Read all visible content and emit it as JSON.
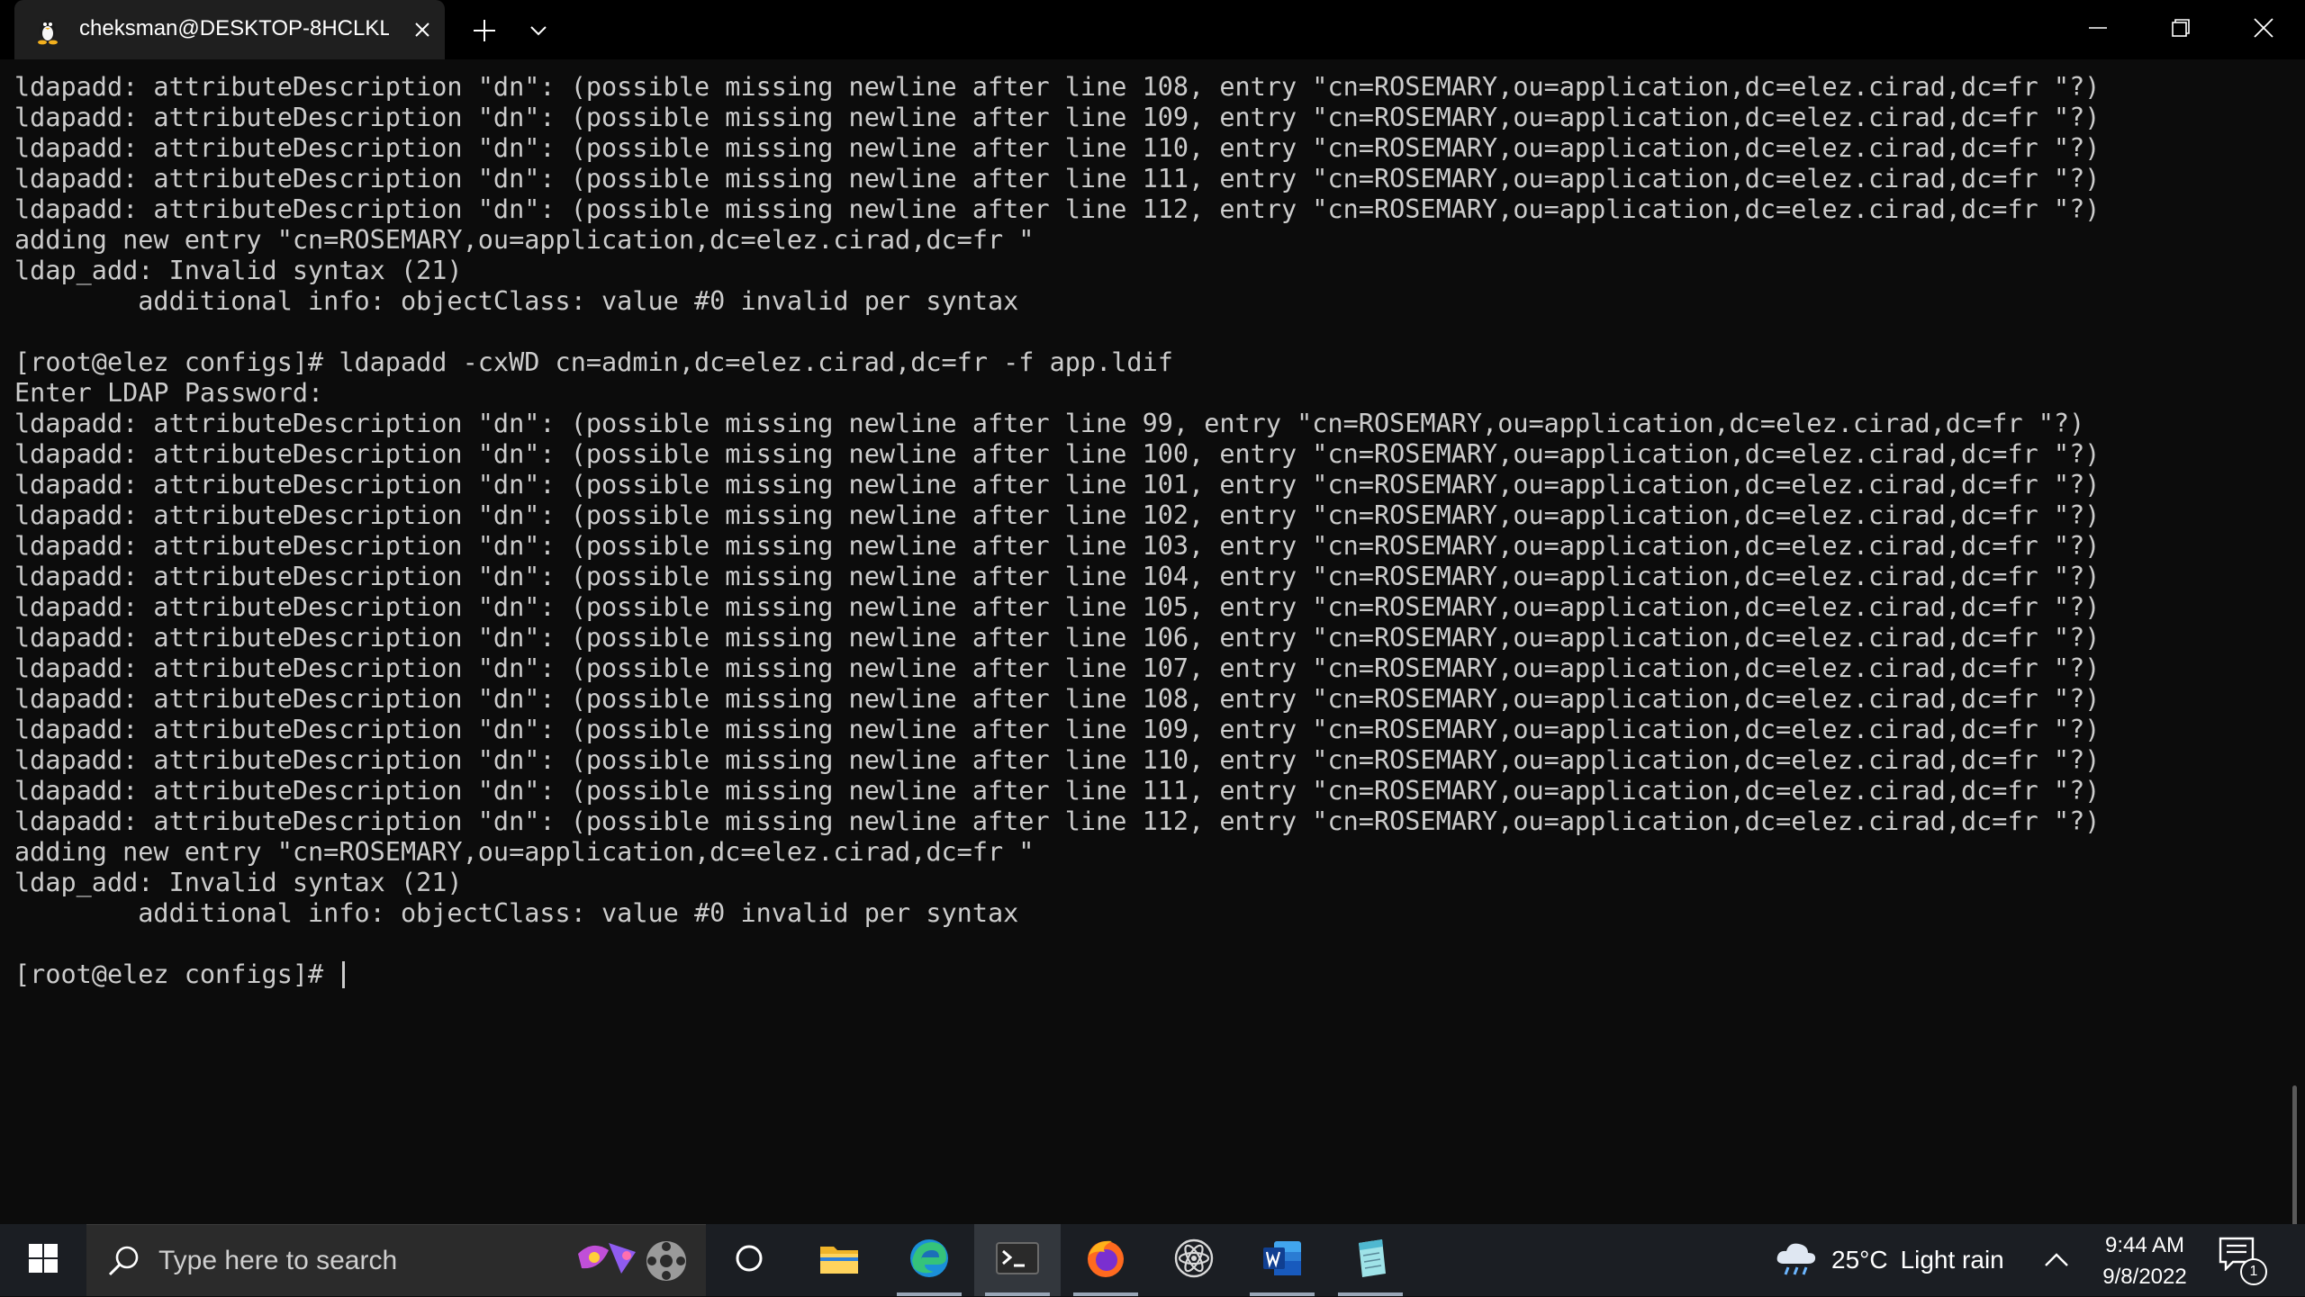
{
  "window": {
    "tab_title": "cheksman@DESKTOP-8HCLKL",
    "tab_icon": "linux-tux-icon"
  },
  "terminal": {
    "lines": [
      "ldapadd: attributeDescription \"dn\": (possible missing newline after line 108, entry \"cn=ROSEMARY,ou=application,dc=elez.cirad,dc=fr \"?)",
      "ldapadd: attributeDescription \"dn\": (possible missing newline after line 109, entry \"cn=ROSEMARY,ou=application,dc=elez.cirad,dc=fr \"?)",
      "ldapadd: attributeDescription \"dn\": (possible missing newline after line 110, entry \"cn=ROSEMARY,ou=application,dc=elez.cirad,dc=fr \"?)",
      "ldapadd: attributeDescription \"dn\": (possible missing newline after line 111, entry \"cn=ROSEMARY,ou=application,dc=elez.cirad,dc=fr \"?)",
      "ldapadd: attributeDescription \"dn\": (possible missing newline after line 112, entry \"cn=ROSEMARY,ou=application,dc=elez.cirad,dc=fr \"?)",
      "adding new entry \"cn=ROSEMARY,ou=application,dc=elez.cirad,dc=fr \"",
      "ldap_add: Invalid syntax (21)",
      "        additional info: objectClass: value #0 invalid per syntax",
      "",
      "[root@elez configs]# ldapadd -cxWD cn=admin,dc=elez.cirad,dc=fr -f app.ldif",
      "Enter LDAP Password:",
      "ldapadd: attributeDescription \"dn\": (possible missing newline after line 99, entry \"cn=ROSEMARY,ou=application,dc=elez.cirad,dc=fr \"?)",
      "ldapadd: attributeDescription \"dn\": (possible missing newline after line 100, entry \"cn=ROSEMARY,ou=application,dc=elez.cirad,dc=fr \"?)",
      "ldapadd: attributeDescription \"dn\": (possible missing newline after line 101, entry \"cn=ROSEMARY,ou=application,dc=elez.cirad,dc=fr \"?)",
      "ldapadd: attributeDescription \"dn\": (possible missing newline after line 102, entry \"cn=ROSEMARY,ou=application,dc=elez.cirad,dc=fr \"?)",
      "ldapadd: attributeDescription \"dn\": (possible missing newline after line 103, entry \"cn=ROSEMARY,ou=application,dc=elez.cirad,dc=fr \"?)",
      "ldapadd: attributeDescription \"dn\": (possible missing newline after line 104, entry \"cn=ROSEMARY,ou=application,dc=elez.cirad,dc=fr \"?)",
      "ldapadd: attributeDescription \"dn\": (possible missing newline after line 105, entry \"cn=ROSEMARY,ou=application,dc=elez.cirad,dc=fr \"?)",
      "ldapadd: attributeDescription \"dn\": (possible missing newline after line 106, entry \"cn=ROSEMARY,ou=application,dc=elez.cirad,dc=fr \"?)",
      "ldapadd: attributeDescription \"dn\": (possible missing newline after line 107, entry \"cn=ROSEMARY,ou=application,dc=elez.cirad,dc=fr \"?)",
      "ldapadd: attributeDescription \"dn\": (possible missing newline after line 108, entry \"cn=ROSEMARY,ou=application,dc=elez.cirad,dc=fr \"?)",
      "ldapadd: attributeDescription \"dn\": (possible missing newline after line 109, entry \"cn=ROSEMARY,ou=application,dc=elez.cirad,dc=fr \"?)",
      "ldapadd: attributeDescription \"dn\": (possible missing newline after line 110, entry \"cn=ROSEMARY,ou=application,dc=elez.cirad,dc=fr \"?)",
      "ldapadd: attributeDescription \"dn\": (possible missing newline after line 111, entry \"cn=ROSEMARY,ou=application,dc=elez.cirad,dc=fr \"?)",
      "ldapadd: attributeDescription \"dn\": (possible missing newline after line 112, entry \"cn=ROSEMARY,ou=application,dc=elez.cirad,dc=fr \"?)",
      "adding new entry \"cn=ROSEMARY,ou=application,dc=elez.cirad,dc=fr \"",
      "ldap_add: Invalid syntax (21)",
      "        additional info: objectClass: value #0 invalid per syntax",
      ""
    ],
    "prompt": "[root@elez configs]# ",
    "colors": {
      "background": "#0c0c0c",
      "foreground": "#cccccc"
    }
  },
  "taskbar": {
    "search_placeholder": "Type here to search",
    "apps": [
      {
        "name": "Cortana",
        "icon": "cortana-circle-icon"
      },
      {
        "name": "File Explorer",
        "icon": "folder-icon"
      },
      {
        "name": "Microsoft Edge",
        "icon": "edge-icon"
      },
      {
        "name": "Windows Terminal",
        "icon": "terminal-icon",
        "active": true
      },
      {
        "name": "Firefox",
        "icon": "firefox-icon"
      },
      {
        "name": "Atom",
        "icon": "atom-icon"
      },
      {
        "name": "Microsoft Word",
        "icon": "word-icon"
      },
      {
        "name": "Notepad",
        "icon": "notepad-icon"
      }
    ],
    "weather": {
      "temperature": "25°C",
      "condition": "Light rain",
      "icon": "rain-cloud-icon"
    },
    "clock": {
      "time": "9:44 AM",
      "date": "9/8/2022"
    },
    "notification_count": "1"
  }
}
